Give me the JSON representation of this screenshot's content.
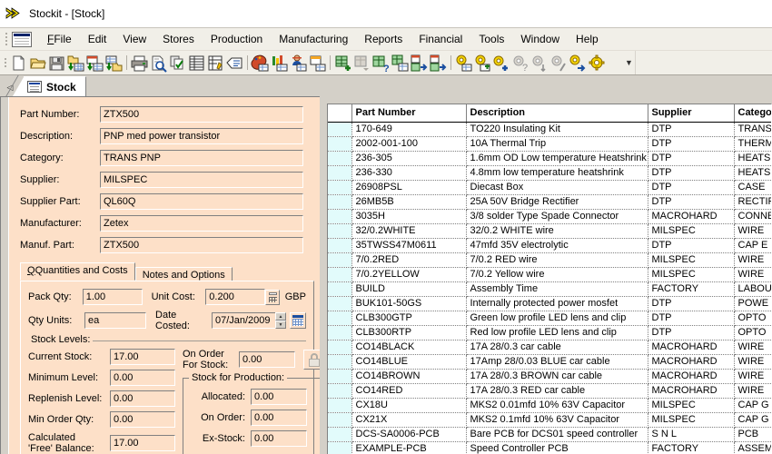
{
  "window": {
    "title": "Stockit - [Stock]",
    "app_icon": "chevrons-icon"
  },
  "menu": {
    "items": [
      {
        "label": "File",
        "accel": "F"
      },
      {
        "label": "Edit",
        "accel": "E"
      },
      {
        "label": "View",
        "accel": "V"
      },
      {
        "label": "Stores",
        "accel": "S"
      },
      {
        "label": "Production",
        "accel": "P"
      },
      {
        "label": "Manufacturing",
        "accel": "M"
      },
      {
        "label": "Reports",
        "accel": "R"
      },
      {
        "label": "Financial",
        "accel": "n"
      },
      {
        "label": "Tools",
        "accel": "T"
      },
      {
        "label": "Window",
        "accel": "W"
      },
      {
        "label": "Help",
        "accel": "H"
      }
    ]
  },
  "toolbar": {
    "buttons": [
      "new-document-icon",
      "open-folder-icon",
      "save-disk-icon",
      "import-to-grid-icon",
      "export-from-grid-icon",
      "grid-to-folder-icon",
      "sep",
      "print-icon",
      "print-preview-icon",
      "copy-records-icon",
      "grid-view-icon",
      "edit-record-icon",
      "label-tag-icon",
      "sep",
      "palette-grid-icon",
      "bar-chart-grid-icon",
      "stock-person-icon",
      "calendar-grid-icon",
      "sep",
      "add-part-icon",
      "remove-part-icon",
      "query-part-icon",
      "copy-part-icon",
      "part-in-icon",
      "part-out-icon",
      "sep",
      "gear-grid-icon",
      "gear-add-icon",
      "gear-plus-icon",
      "gear-query-icon",
      "gear-sort-icon",
      "gear-slash-icon",
      "gear-arrow-icon",
      "gear-icon"
    ],
    "overflow_label": "▼"
  },
  "tabstrip": {
    "nav_prev": "◁",
    "tabs": [
      {
        "label": "Stock",
        "icon": "document-lines-icon",
        "active": true
      }
    ]
  },
  "form": {
    "header_fields": [
      {
        "label": "Part Number:",
        "value": "ZTX500",
        "name": "part-number"
      },
      {
        "label": "Description:",
        "value": "PNP med power transistor",
        "name": "description"
      },
      {
        "label": "Category:",
        "value": "TRANS PNP",
        "name": "category"
      },
      {
        "label": "Supplier:",
        "value": "MILSPEC",
        "name": "supplier"
      },
      {
        "label": "Supplier Part:",
        "value": "QL60Q",
        "name": "supplier-part"
      },
      {
        "label": "Manufacturer:",
        "value": "Zetex",
        "name": "manufacturer"
      },
      {
        "label": "Manuf. Part:",
        "value": "ZTX500",
        "name": "manuf-part"
      }
    ],
    "inner_tabs": [
      {
        "label": "Quantities and Costs",
        "accel": "Q",
        "active": true
      },
      {
        "label": "Notes and Options",
        "accel": "N",
        "active": false
      }
    ],
    "quantities": {
      "pack_qty_label": "Pack Qty:",
      "pack_qty_value": "1.00",
      "qty_units_label": "Qty Units:",
      "qty_units_value": "ea",
      "unit_cost_label": "Unit Cost:",
      "unit_cost_value": "0.200",
      "currency": "GBP",
      "date_costed_label": "Date Costed:",
      "date_costed_value": "07/Jan/2009"
    },
    "stock_levels": {
      "group_label": "Stock Levels:",
      "current_stock_label": "Current Stock:",
      "current_stock_value": "17.00",
      "minimum_level_label": "Minimum Level:",
      "minimum_level_value": "0.00",
      "replenish_level_label": "Replenish Level:",
      "replenish_level_value": "0.00",
      "min_order_qty_label": "Min Order Qty:",
      "min_order_qty_value": "0.00",
      "free_balance_label_1": "Calculated",
      "free_balance_label_2": "'Free' Balance:",
      "free_balance_value": "17.00",
      "on_order_label_1": "On Order",
      "on_order_label_2": "For Stock:",
      "on_order_value": "0.00"
    },
    "stock_for_production": {
      "group_label": "Stock for Production:",
      "allocated_label": "Allocated:",
      "allocated_value": "0.00",
      "on_order_label": "On Order:",
      "on_order_value": "0.00",
      "ex_stock_label": "Ex-Stock:",
      "ex_stock_value": "0.00"
    }
  },
  "grid": {
    "columns": [
      "",
      "Part Number",
      "Description",
      "Supplier",
      "Category"
    ],
    "rows": [
      [
        "170-649",
        "TO220 Insulating Kit",
        "DTP",
        "TRANS"
      ],
      [
        "2002-001-100",
        "10A Thermal Trip",
        "DTP",
        "THERM"
      ],
      [
        "236-305",
        "1.6mm OD Low temperature Heatshrink",
        "DTP",
        "HEATS"
      ],
      [
        "236-330",
        "4.8mm low temperature heatshrink",
        "DTP",
        "HEATS"
      ],
      [
        "26908PSL",
        "Diecast Box",
        "DTP",
        "CASE"
      ],
      [
        "26MB5B",
        "25A 50V Bridge Rectifier",
        "DTP",
        "RECTIF"
      ],
      [
        "3035H",
        "3/8 solder Type Spade Connector",
        "MACROHARD",
        "CONNE"
      ],
      [
        "32/0.2WHITE",
        "32/0.2 WHITE wire",
        "MILSPEC",
        "WIRE"
      ],
      [
        "35TWSS47M0611",
        "47mfd 35V electrolytic",
        "DTP",
        "CAP E"
      ],
      [
        "7/0.2RED",
        "7/0.2 RED wire",
        "MILSPEC",
        "WIRE"
      ],
      [
        "7/0.2YELLOW",
        "7/0.2 Yellow wire",
        "MILSPEC",
        "WIRE"
      ],
      [
        "BUILD",
        "Assembly Time",
        "FACTORY",
        "LABOU"
      ],
      [
        "BUK101-50GS",
        "Internally protected power mosfet",
        "DTP",
        "POWE"
      ],
      [
        "CLB300GTP",
        "Green low profile LED lens and clip",
        "DTP",
        "OPTO"
      ],
      [
        "CLB300RTP",
        "Red low profile LED lens and clip",
        "DTP",
        "OPTO"
      ],
      [
        "CO14BLACK",
        "17A 28/0.3 car cable",
        "MACROHARD",
        "WIRE"
      ],
      [
        "CO14BLUE",
        "17Amp 28/0.03 BLUE car cable",
        "MACROHARD",
        "WIRE"
      ],
      [
        "CO14BROWN",
        "17A 28/0.3 BROWN car cable",
        "MACROHARD",
        "WIRE"
      ],
      [
        "CO14RED",
        "17A 28/0.3 RED car cable",
        "MACROHARD",
        "WIRE"
      ],
      [
        "CX18U",
        "MKS2 0.01mfd 10% 63V Capacitor",
        "MILSPEC",
        "CAP G"
      ],
      [
        "CX21X",
        "MKS2 0.1mfd 10% 63V Capacitor",
        "MILSPEC",
        "CAP G"
      ],
      [
        "DCS-SA0006-PCB",
        "Bare PCB for DCS01 speed controller",
        "S N L",
        "PCB"
      ],
      [
        "EXAMPLE-PCB",
        "Speed Controller PCB",
        "FACTORY",
        "ASSEM"
      ]
    ]
  },
  "colors": {
    "form_background": "#fde0c8",
    "chrome": "#d4d0c8",
    "menu_background": "#f1efe8",
    "grid_selector": "#e2fbfb",
    "title_background": "#ffffff"
  }
}
